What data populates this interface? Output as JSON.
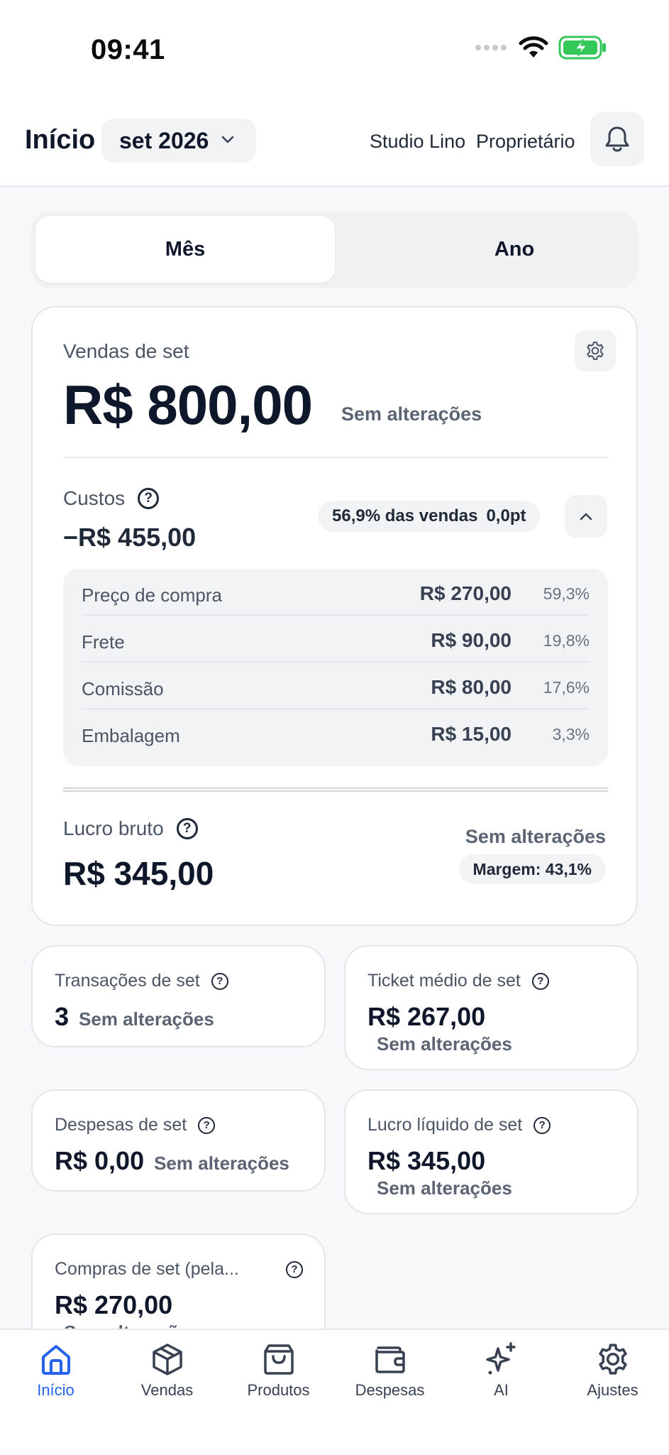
{
  "status_bar": {
    "time": "09:41"
  },
  "header": {
    "title": "Início",
    "month": "set 2026",
    "store": "Studio Lino",
    "role": "Proprietário"
  },
  "period_tabs": [
    {
      "label": "Mês",
      "active": true
    },
    {
      "label": "Ano",
      "active": false
    }
  ],
  "sales_card": {
    "label": "Vendas de set",
    "value": "R$ 800,00",
    "change": "Sem alterações",
    "costs": {
      "label": "Custos",
      "value": "−R$ 455,00",
      "percent_of_sales": "56,9% das vendas",
      "delta": "0,0pt",
      "breakdown": [
        {
          "name": "Preço de compra",
          "amount": "R$ 270,00",
          "percent": "59,3%"
        },
        {
          "name": "Frete",
          "amount": "R$ 90,00",
          "percent": "19,8%"
        },
        {
          "name": "Comissão",
          "amount": "R$ 80,00",
          "percent": "17,6%"
        },
        {
          "name": "Embalagem",
          "amount": "R$ 15,00",
          "percent": "3,3%"
        }
      ]
    },
    "gross_profit": {
      "label": "Lucro bruto",
      "value": "R$ 345,00",
      "change": "Sem alterações",
      "margin": "Margem: 43,1%"
    }
  },
  "metric_cards": {
    "transactions": {
      "label": "Transações de set",
      "value": "3",
      "change": "Sem alterações"
    },
    "avg_ticket": {
      "label": "Ticket médio de set",
      "value": "R$ 267,00",
      "change": "Sem alterações"
    },
    "expenses": {
      "label": "Despesas de set",
      "value": "R$ 0,00",
      "change": "Sem alterações"
    },
    "net_profit": {
      "label": "Lucro líquido de set",
      "value": "R$ 345,00",
      "change": "Sem alterações"
    },
    "purchases": {
      "label": "Compras de set (pela...",
      "value": "R$ 270,00",
      "change": "Sem alterações"
    }
  },
  "tab_bar": [
    {
      "label": "Início",
      "icon": "home-icon",
      "active": true
    },
    {
      "label": "Vendas",
      "icon": "box-icon",
      "active": false
    },
    {
      "label": "Produtos",
      "icon": "shopping-bag-icon",
      "active": false
    },
    {
      "label": "Despesas",
      "icon": "wallet-icon",
      "active": false
    },
    {
      "label": "AI",
      "icon": "sparkles-icon",
      "active": false
    },
    {
      "label": "Ajustes",
      "icon": "settings-icon",
      "active": false
    }
  ],
  "colors": {
    "accent": "#2563eb",
    "text": "#0f172a",
    "muted": "#4b5563",
    "battery": "#34c759"
  }
}
